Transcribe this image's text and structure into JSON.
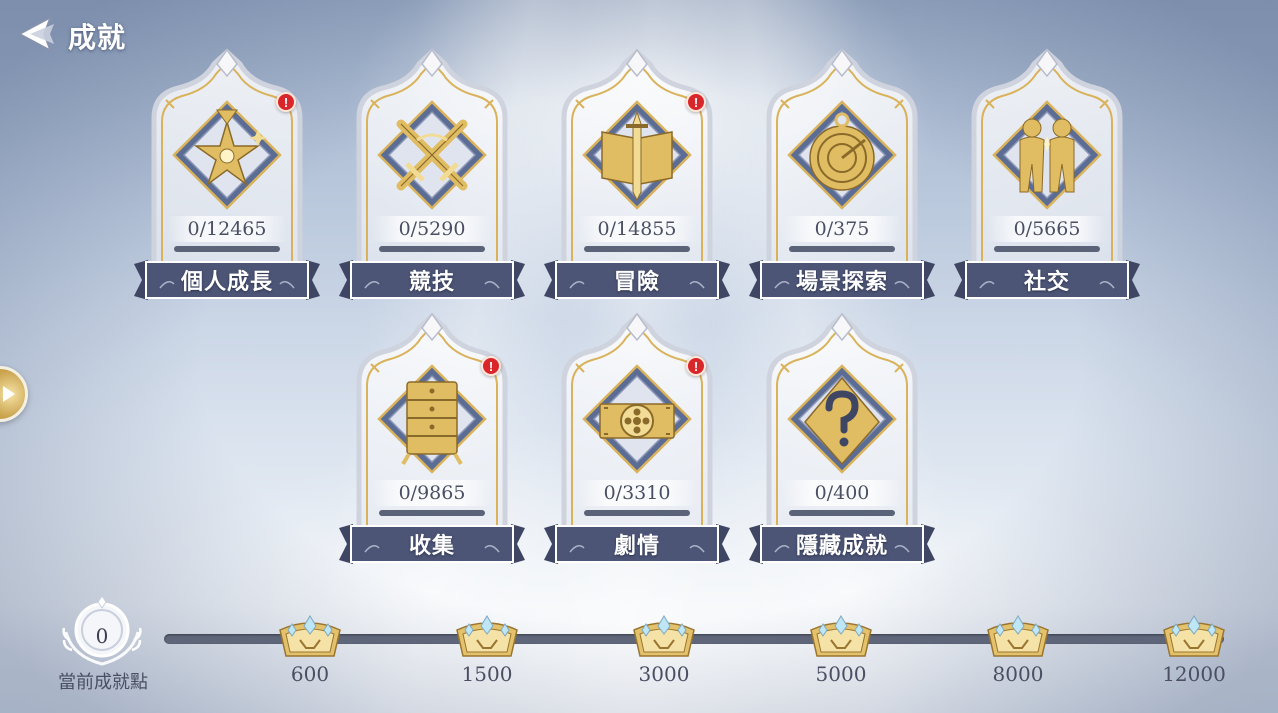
{
  "header": {
    "title": "成就"
  },
  "categories": [
    {
      "name": "個人成長",
      "progress": "0/12465",
      "alert": "!",
      "icon": "star-compass-icon"
    },
    {
      "name": "競技",
      "progress": "0/5290",
      "icon": "crossed-swords-icon"
    },
    {
      "name": "冒險",
      "progress": "0/14855",
      "alert": "!",
      "icon": "book-sword-icon"
    },
    {
      "name": "場景探索",
      "progress": "0/375",
      "icon": "compass-icon"
    },
    {
      "name": "社交",
      "progress": "0/5665",
      "icon": "two-people-icon"
    },
    {
      "name": "收集",
      "progress": "0/9865",
      "alert": "!",
      "icon": "cabinet-icon"
    },
    {
      "name": "劇情",
      "progress": "0/3310",
      "alert": "!",
      "icon": "film-reel-icon"
    },
    {
      "name": "隱藏成就",
      "progress": "0/400",
      "icon": "question-mark-icon"
    }
  ],
  "points": {
    "value": "0",
    "label": "當前成就點",
    "progress_fraction": 0
  },
  "milestones": [
    "600",
    "1500",
    "3000",
    "5000",
    "8000",
    "12000"
  ],
  "colors": {
    "gold": "#e0bd62",
    "ribbon": "#4d5577",
    "alert": "#d8262b",
    "frame": "#f1f1f4"
  }
}
